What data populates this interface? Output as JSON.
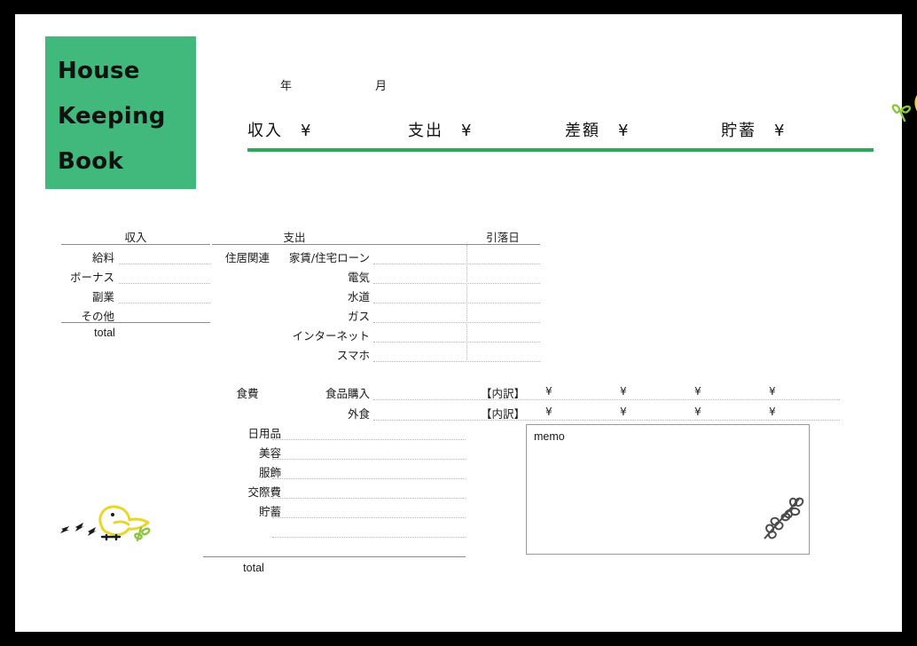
{
  "title": {
    "lines": [
      "House",
      "Keeping",
      "Book"
    ],
    "bg_color": "#41b87c"
  },
  "header": {
    "year_label": "年",
    "month_label": "月",
    "summary": [
      {
        "label": "収入　¥"
      },
      {
        "label": "支出　¥"
      },
      {
        "label": "差額　¥"
      },
      {
        "label": "貯蓄　¥"
      }
    ],
    "rule_color": "#2fa55e"
  },
  "income_table": {
    "heading": "収入",
    "rows": [
      {
        "label": "給料"
      },
      {
        "label": "ボーナス"
      },
      {
        "label": "副業"
      },
      {
        "label": "その他"
      }
    ],
    "total_label": "total"
  },
  "expense_table": {
    "heading": "支出",
    "date_heading": "引落日",
    "groups": [
      {
        "group_label": "住居関連",
        "rows": [
          {
            "label": "家賃/住宅ローン"
          },
          {
            "label": "電気"
          },
          {
            "label": "水道"
          },
          {
            "label": "ガス"
          },
          {
            "label": "インターネット"
          },
          {
            "label": "スマホ"
          }
        ]
      },
      {
        "group_label": "食費",
        "rows": [
          {
            "label": "食品購入",
            "breakdown_label": "【内訳】",
            "yen_slots": [
              "¥",
              "¥",
              "¥",
              "¥"
            ]
          },
          {
            "label": "外食",
            "breakdown_label": "【内訳】",
            "yen_slots": [
              "¥",
              "¥",
              "¥",
              "¥"
            ]
          }
        ]
      }
    ],
    "other_rows": [
      {
        "label": "日用品"
      },
      {
        "label": "美容"
      },
      {
        "label": "服飾"
      },
      {
        "label": "交際費"
      },
      {
        "label": "貯蓄"
      },
      {
        "label": ""
      },
      {
        "label": ""
      }
    ],
    "total_label": "total"
  },
  "memo": {
    "label": "memo"
  },
  "decorations": {
    "bird_top": "bird-icon",
    "bird_bottom": "bird-icon",
    "memo_vine": "leaf-vine-icon",
    "bird_body_color": "#e8d72b",
    "leaf_color": "#8cc63e"
  }
}
